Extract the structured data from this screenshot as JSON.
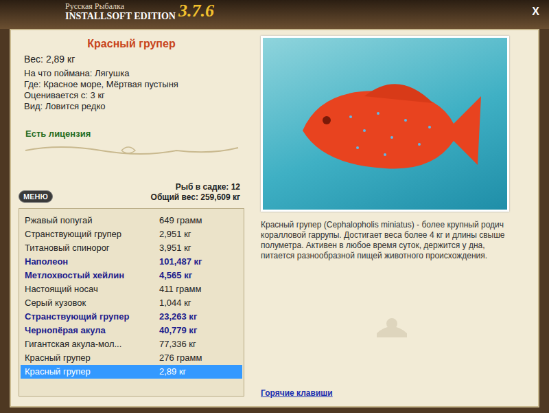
{
  "window": {
    "title_line1": "Русская Рыбалка",
    "title_line2": "INSTALLSOFT EDITION",
    "version": "3.7.6",
    "close": "X"
  },
  "fish": {
    "name": "Красный групер",
    "weight": "Вес: 2,89 кг",
    "details": [
      "На что поймана: Лягушка",
      "Где: Красное море, Мёртвая пустыня",
      "Оценивается с: 3 кг",
      "Вид: Ловится редко"
    ],
    "license": "Есть лицензия"
  },
  "menu_button": "МЕНЮ",
  "keepnet": {
    "count": "Рыб в садке: 12",
    "total": "Общий вес: 259,609 кг"
  },
  "catch_list": [
    {
      "name": "Ржавый попугай",
      "weight": "649 грамм",
      "trophy": false,
      "selected": false
    },
    {
      "name": "Странствующий групер",
      "weight": "2,951 кг",
      "trophy": false,
      "selected": false
    },
    {
      "name": "Титановый спинорог",
      "weight": "3,951 кг",
      "trophy": false,
      "selected": false
    },
    {
      "name": "Наполеон",
      "weight": "101,487 кг",
      "trophy": true,
      "selected": false
    },
    {
      "name": "Метлохвостый хейлин",
      "weight": "4,565 кг",
      "trophy": true,
      "selected": false
    },
    {
      "name": "Настоящий носач",
      "weight": "411 грамм",
      "trophy": false,
      "selected": false
    },
    {
      "name": "Серый кузовок",
      "weight": "1,044 кг",
      "trophy": false,
      "selected": false
    },
    {
      "name": "Странствующий групер",
      "weight": "23,263 кг",
      "trophy": true,
      "selected": false
    },
    {
      "name": "Чернопёрая акула",
      "weight": "40,779 кг",
      "trophy": true,
      "selected": false
    },
    {
      "name": "Гигантская акула-мол...",
      "weight": "77,336 кг",
      "trophy": false,
      "selected": false
    },
    {
      "name": "Красный групер",
      "weight": "276 грамм",
      "trophy": false,
      "selected": false
    },
    {
      "name": "Красный групер",
      "weight": "2,89 кг",
      "trophy": false,
      "selected": true
    }
  ],
  "description": "Красный групер (Cephalopholis miniatus) - более крупный родич коралловой гаррупы. Достигает веса более 4 кг и длины свыше полуметра. Активен в любое время суток, держится у дна, питается разнообразной пищей животного происхождения.",
  "hotkeys_link": "Горячие клавиши"
}
